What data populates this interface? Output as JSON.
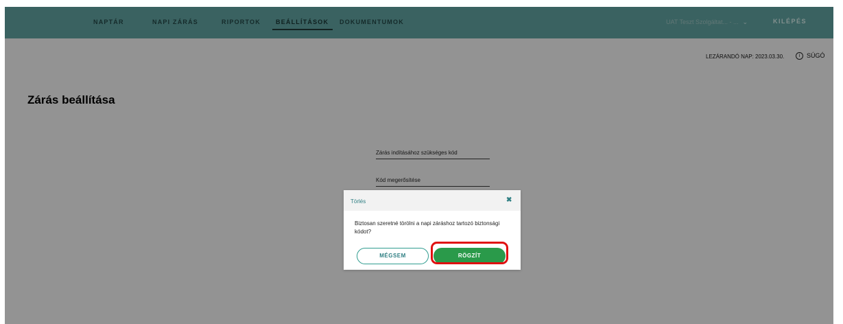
{
  "nav": {
    "items": [
      {
        "label": "NAPTÁR"
      },
      {
        "label": "NAPI ZÁRÁS"
      },
      {
        "label": "RIPORTOK"
      },
      {
        "label": "BEÁLLÍTÁSOK",
        "active": true
      },
      {
        "label": "DOKUMENTUMOK"
      }
    ],
    "user_select": "UAT Teszt Szolgáltat... - ...",
    "logout": "KILÉPÉS"
  },
  "header": {
    "closing_day": "LEZÁRANDÓ NAP: 2023.03.30.",
    "help": "SÚGÓ",
    "help_icon": "i"
  },
  "page": {
    "title": "Zárás beállítása",
    "fields": [
      {
        "label": "Zárás indításához szükséges kód"
      },
      {
        "label": "Kód megerősítése"
      }
    ]
  },
  "modal": {
    "title": "Törlés",
    "close_glyph": "✖",
    "message": "Biztosan szeretné törölni a napi záráshoz tartozó biztonsági kódot?",
    "cancel_label": "MÉGSEM",
    "save_label": "RÖGZÍT"
  },
  "colors": {
    "nav_bg": "#56918f",
    "accent": "#2f7f83",
    "save_button": "#2a9a4a",
    "highlight": "#e01010"
  }
}
